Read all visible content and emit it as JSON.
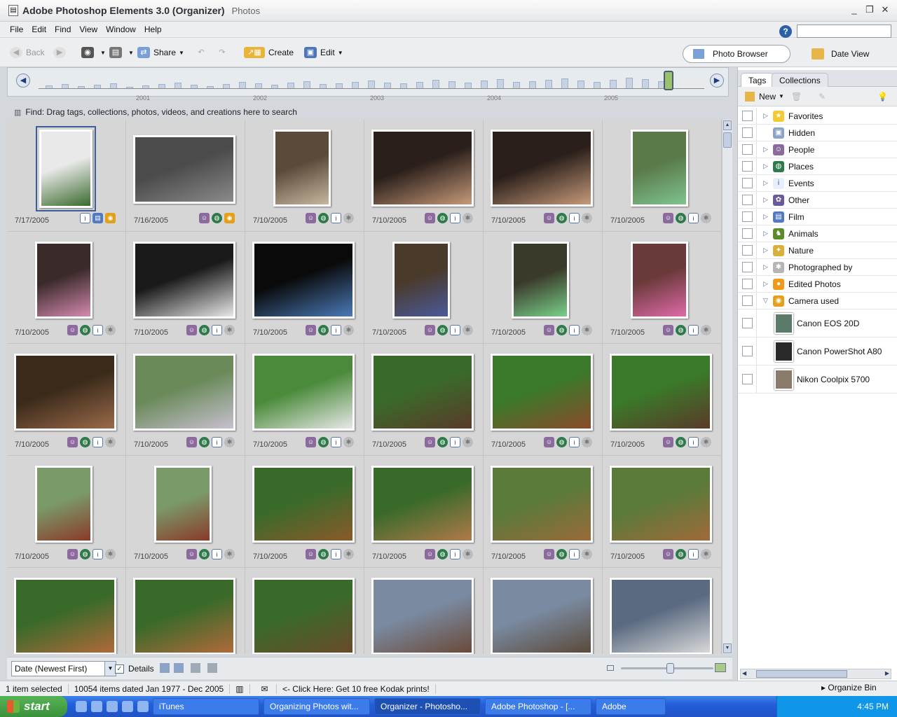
{
  "window": {
    "title": "Adobe Photoshop Elements 3.0 (Organizer)",
    "subtitle": "Photos"
  },
  "menu": [
    "File",
    "Edit",
    "Find",
    "View",
    "Window",
    "Help"
  ],
  "toolbar": {
    "back": "Back",
    "share": "Share",
    "create": "Create",
    "edit": "Edit",
    "photo_browser": "Photo Browser",
    "date_view": "Date View"
  },
  "timeline": {
    "years": [
      "2001",
      "2002",
      "2003",
      "2004",
      "2005"
    ]
  },
  "find": {
    "text": "Find: Drag tags, collections, photos, videos, and creations here to search"
  },
  "photos": [
    [
      "7/17/2005",
      "7/16/2005",
      "7/10/2005",
      "7/10/2005",
      "7/10/2005",
      "7/10/2005"
    ],
    [
      "7/10/2005",
      "7/10/2005",
      "7/10/2005",
      "7/10/2005",
      "7/10/2005",
      "7/10/2005"
    ],
    [
      "7/10/2005",
      "7/10/2005",
      "7/10/2005",
      "7/10/2005",
      "7/10/2005",
      "7/10/2005"
    ],
    [
      "7/10/2005",
      "7/10/2005",
      "7/10/2005",
      "7/10/2005",
      "7/10/2005",
      "7/10/2005"
    ]
  ],
  "bottom": {
    "sort": "Date (Newest First)",
    "details": "Details"
  },
  "status": {
    "selected": "1 item selected",
    "count": "10054 items dated Jan 1977 - Dec 2005",
    "promo": "<- Click Here: Get 10 free Kodak prints!"
  },
  "side": {
    "tab_tags": "Tags",
    "tab_collections": "Collections",
    "new": "New",
    "tags": [
      "Favorites",
      "Hidden",
      "People",
      "Places",
      "Events",
      "Other",
      "Film",
      "Animals",
      "Nature",
      "Photographed by",
      "Edited Photos",
      "Camera used"
    ],
    "cameras": [
      "Canon EOS 20D",
      "Canon PowerShot A80",
      "Nikon Coolpix 5700"
    ],
    "organize": "Organize Bin"
  },
  "taskbar": {
    "start": "start",
    "items": [
      "iTunes",
      "Organizing Photos wit...",
      "Organizer - Photosho...",
      "Adobe Photoshop - [...",
      "Adobe"
    ],
    "time": "4:45 PM"
  }
}
